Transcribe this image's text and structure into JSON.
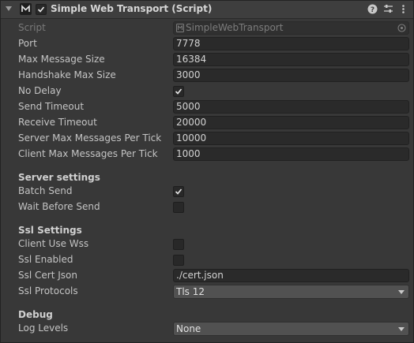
{
  "component": {
    "title": "Simple Web Transport (Script)",
    "enabled": true
  },
  "script": {
    "label": "Script",
    "value": "SimpleWebTransport"
  },
  "fields": {
    "port": {
      "label": "Port",
      "value": "7778"
    },
    "max_message_size": {
      "label": "Max Message Size",
      "value": "16384"
    },
    "handshake_max_size": {
      "label": "Handshake Max Size",
      "value": "3000"
    },
    "no_delay": {
      "label": "No Delay",
      "checked": true
    },
    "send_timeout": {
      "label": "Send Timeout",
      "value": "5000"
    },
    "receive_timeout": {
      "label": "Receive Timeout",
      "value": "20000"
    },
    "server_max_messages": {
      "label": "Server Max Messages Per Tick",
      "value": "10000"
    },
    "client_max_messages": {
      "label": "Client Max Messages Per Tick",
      "value": "1000"
    }
  },
  "server_settings": {
    "title": "Server settings",
    "batch_send": {
      "label": "Batch Send",
      "checked": true
    },
    "wait_before_send": {
      "label": "Wait Before Send",
      "checked": false
    }
  },
  "ssl_settings": {
    "title": "Ssl Settings",
    "client_use_wss": {
      "label": "Client Use Wss",
      "checked": false
    },
    "ssl_enabled": {
      "label": "Ssl Enabled",
      "checked": false
    },
    "ssl_cert_json": {
      "label": "Ssl Cert Json",
      "value": "./cert.json"
    },
    "ssl_protocols": {
      "label": "Ssl Protocols",
      "value": "Tls 12"
    }
  },
  "debug": {
    "title": "Debug",
    "log_levels": {
      "label": "Log Levels",
      "value": "None"
    }
  },
  "icons": {
    "foldout": "foldout-arrow-icon",
    "script": "mirror-script-icon",
    "help": "help-icon",
    "presets": "presets-icon",
    "more": "more-options-icon",
    "object_picker": "object-picker-icon"
  },
  "colors": {
    "background": "#383838",
    "header": "#3e3e3e",
    "field": "#2a2a2a",
    "dropdown": "#515151",
    "text": "#c4c4c4"
  }
}
